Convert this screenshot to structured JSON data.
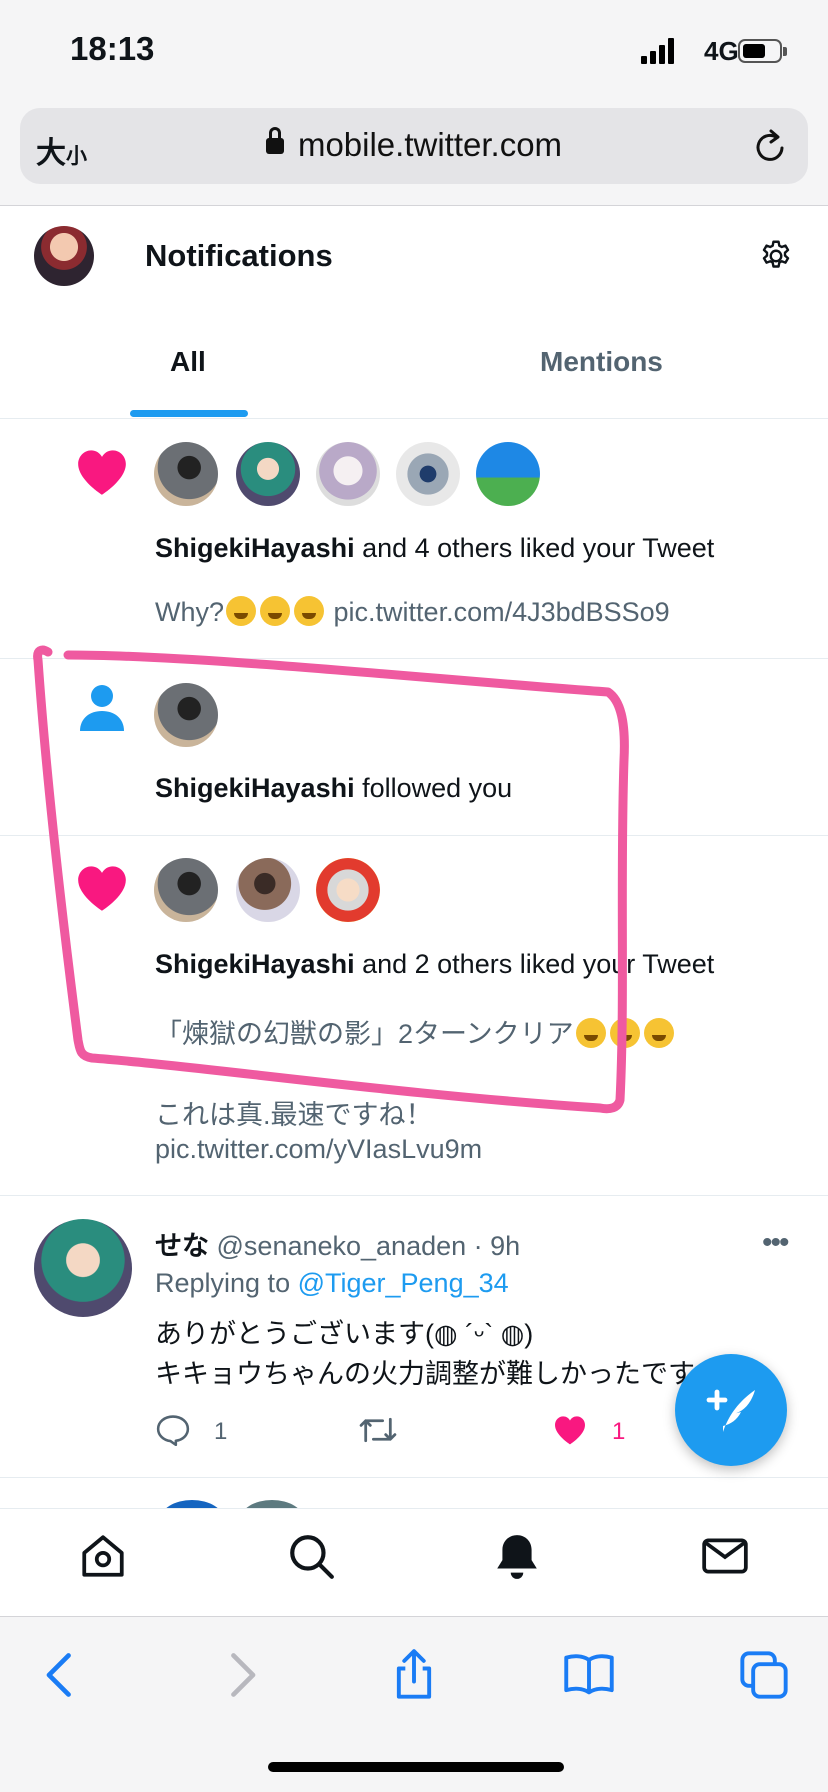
{
  "status_bar": {
    "time": "18:13",
    "network": "4G"
  },
  "browser": {
    "text_size_big": "大",
    "text_size_small": "小",
    "url": "mobile.twitter.com"
  },
  "header": {
    "title": "Notifications"
  },
  "tabs": [
    {
      "label": "All",
      "active": true
    },
    {
      "label": "Mentions",
      "active": false
    }
  ],
  "notifications": [
    {
      "type": "like",
      "user": "ShigekiHayashi",
      "action": " and 4 others liked your Tweet",
      "tweet_prefix": "Why?",
      "tweet_link": " pic.twitter.com/4J3bdBSSo9"
    },
    {
      "type": "follow",
      "user": "ShigekiHayashi",
      "action": " followed you"
    },
    {
      "type": "like",
      "user": "ShigekiHayashi",
      "action": " and 2 others liked your Tweet",
      "tweet_line1": "「煉獄の幻獣の影」2ターンクリア",
      "tweet_line2": "これは真.最速ですね！",
      "tweet_line3": "pic.twitter.com/yVIasLvu9m"
    }
  ],
  "tweet": {
    "name": "せな",
    "handle": "@senaneko_anaden · 9h",
    "replying_label": "Replying to ",
    "replying_to": "@Tiger_Peng_34",
    "line1": "ありがとうございます(◍ ´ᵕ` ◍)",
    "line2": "キキョウちゃんの火力調整が難しかったです😅笑",
    "reply_count": "1",
    "like_count": "1"
  },
  "colors": {
    "accent": "#1d9bf0",
    "like": "#f91880",
    "annotation": "#ef5aa0"
  }
}
